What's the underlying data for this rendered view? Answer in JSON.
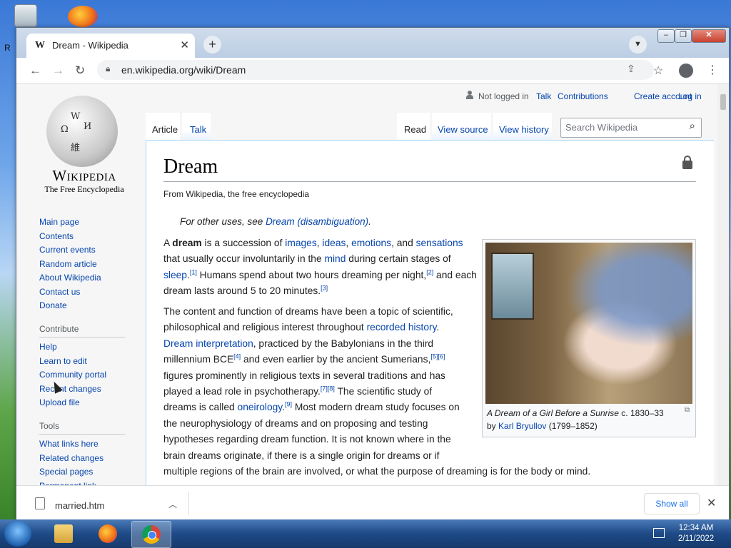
{
  "browser": {
    "tab_title": "Dream - Wikipedia",
    "tab_favicon": "W",
    "url": "en.wikipedia.org/wiki/Dream",
    "icons": [
      "back-icon",
      "forward-icon",
      "reload-icon",
      "lock-icon",
      "share-icon",
      "star-icon",
      "profile-icon",
      "menu-icon"
    ]
  },
  "wiki": {
    "wordmark": "Wikipedia",
    "tagline": "The Free Encyclopedia",
    "personal": {
      "not_logged_in": "Not logged in",
      "talk": "Talk",
      "contributions": "Contributions",
      "create_account": "Create account",
      "log_in": "Log in"
    },
    "tabs": {
      "article": "Article",
      "talk": "Talk",
      "read": "Read",
      "view_source": "View source",
      "view_history": "View history"
    },
    "search_placeholder": "Search Wikipedia",
    "nav": [
      "Main page",
      "Contents",
      "Current events",
      "Random article",
      "About Wikipedia",
      "Contact us",
      "Donate"
    ],
    "contribute_heading": "Contribute",
    "contribute": [
      "Help",
      "Learn to edit",
      "Community portal",
      "Recent changes",
      "Upload file"
    ],
    "tools_heading": "Tools",
    "tools": [
      "What links here",
      "Related changes",
      "Special pages",
      "Permanent link"
    ]
  },
  "article": {
    "title": "Dream",
    "site_sub": "From Wikipedia, the free encyclopedia",
    "hatnote_prefix": "For other uses, see ",
    "hatnote_link": "Dream (disambiguation)",
    "hatnote_suffix": ".",
    "caption_italic": "A Dream of a Girl Before a Sunrise",
    "caption_date": " c. 1830–33 by ",
    "caption_author": "Karl Bryullov",
    "caption_years": " (1799–1852)"
  },
  "downloads": {
    "file_name": "married.htm",
    "show_all": "Show all"
  },
  "taskbar": {
    "time": "12:34 AM",
    "date": "2/11/2022"
  }
}
